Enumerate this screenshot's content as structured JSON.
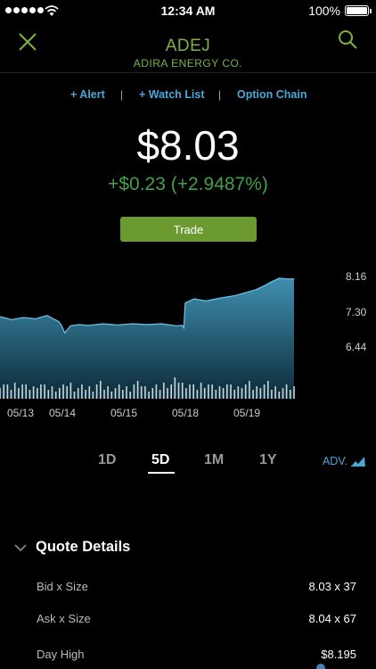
{
  "status_bar": {
    "time": "12:34 AM",
    "battery": "100%"
  },
  "header": {
    "symbol": "ADEJ",
    "company": "ADIRA ENERGY CO."
  },
  "actions": {
    "alert": "+ Alert",
    "watch_list": "+ Watch List",
    "option_chain": "Option Chain",
    "separator": "|"
  },
  "quote": {
    "price": "$8.03",
    "change": "+$0.23 (+2.9487%)"
  },
  "trade_label": "Trade",
  "colors": {
    "accent_green": "#7cb342",
    "change_green": "#43a047",
    "link_blue": "#4aa8d8",
    "button_green": "#6b9a31",
    "chart_fill_top": "#3f8fb0",
    "chart_fill_bottom": "#0d2a38"
  },
  "icons": {
    "close": "close-icon",
    "search": "search-icon",
    "advanced": "advanced-chart-icon",
    "chevron": "chevron-down-icon"
  },
  "chart_data": {
    "type": "area",
    "x": [
      0,
      0.04,
      0.08,
      0.12,
      0.16,
      0.2,
      0.21,
      0.22,
      0.24,
      0.27,
      0.3,
      0.35,
      0.4,
      0.45,
      0.5,
      0.55,
      0.6,
      0.62,
      0.625,
      0.63,
      0.66,
      0.7,
      0.75,
      0.8,
      0.85,
      0.87,
      0.9,
      0.92,
      0.95,
      0.98,
      1.0
    ],
    "values": [
      7.17,
      7.1,
      7.15,
      7.12,
      7.2,
      7.05,
      6.95,
      6.78,
      6.95,
      6.98,
      6.96,
      7.0,
      6.97,
      7.0,
      6.98,
      7.0,
      6.95,
      6.96,
      6.9,
      7.5,
      7.6,
      7.55,
      7.62,
      7.68,
      7.78,
      7.82,
      7.92,
      8.0,
      8.1,
      8.08,
      8.08
    ],
    "volume": [
      3,
      2,
      3,
      2,
      3,
      2,
      2,
      3,
      2,
      2,
      3,
      2,
      2,
      2,
      3,
      2,
      2,
      3,
      4,
      3,
      2,
      3,
      2,
      3,
      2,
      3,
      2,
      3,
      2,
      2,
      2
    ],
    "y_ticks": [
      "8.16",
      "7.30",
      "6.44"
    ],
    "ylim": [
      6.44,
      8.16
    ],
    "x_ticks": [
      "05/13",
      "05/14",
      "05/15",
      "05/18",
      "05/19"
    ],
    "grid": false
  },
  "ranges": {
    "tabs": [
      "1D",
      "5D",
      "1M",
      "1Y"
    ],
    "selected": "5D",
    "advanced_label": "ADV."
  },
  "quote_details": {
    "title": "Quote Details",
    "rows": [
      {
        "label": "Bid x Size",
        "value": "8.03 x 37"
      },
      {
        "label": "Ask x Size",
        "value": "8.04 x 67"
      },
      {
        "label": "Day High",
        "value": "$8.195"
      }
    ]
  }
}
